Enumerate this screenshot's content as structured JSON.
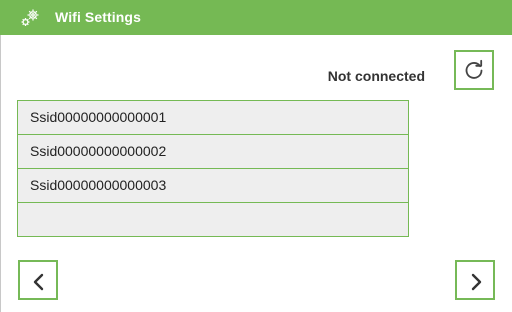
{
  "header": {
    "title": "Wifi Settings",
    "icon": "gears-icon",
    "background_color": "#75b954",
    "text_color": "#ffffff"
  },
  "status": {
    "text": "Not connected"
  },
  "refresh": {
    "icon": "refresh-icon"
  },
  "networks": [
    {
      "ssid": "Ssid00000000000001"
    },
    {
      "ssid": "Ssid00000000000002"
    },
    {
      "ssid": "Ssid00000000000003"
    },
    {
      "ssid": ""
    }
  ],
  "navigation": {
    "prev_icon": "chevron-left-icon",
    "next_icon": "chevron-right-icon"
  },
  "colors": {
    "accent": "#75b954",
    "list_background": "#eeeeee",
    "text": "#222222"
  }
}
